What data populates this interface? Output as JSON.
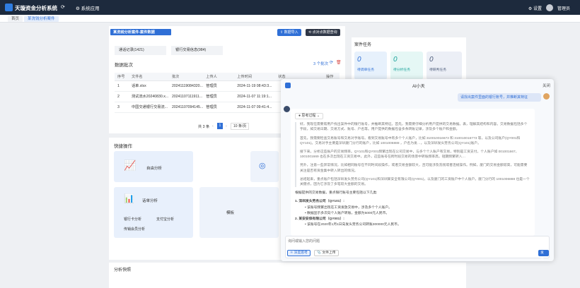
{
  "header": {
    "title": "天璇资金分析系统",
    "sys_app": "系统应用",
    "settings": "设置",
    "user": "管理员"
  },
  "tabs": [
    {
      "label": "首页"
    },
    {
      "label": "某洗钱分析案件"
    }
  ],
  "case_panel": {
    "title": "某洗钱分析案件-案件数据",
    "import_btn": "数据导入",
    "query_btn": "点对点数据查询",
    "sub_tabs": [
      "通话记录(1421)",
      "银行交易信息(984)"
    ],
    "batch_title": "数据批次",
    "batch_count": "3 个批次",
    "columns": [
      "序号",
      "文件名",
      "批次",
      "上传人",
      "上传时间",
      "状态",
      "操作"
    ],
    "rows": [
      [
        "1",
        "话单.xlsx",
        "20241119084320...",
        "管理员",
        "2024-11-19 08:43:3..."
      ],
      [
        "2",
        "测试流水20240830.x...",
        "20241107111911...",
        "管理员",
        "2024-11-07 11:19:1..."
      ],
      [
        "3",
        "中国交通银行交易流...",
        "20241107094145...",
        "管理员",
        "2024-11-07 09:41:4..."
      ]
    ],
    "pagination": {
      "total": "共 3 条",
      "page": "1",
      "size": "10 条/页"
    }
  },
  "tasks": {
    "title": "案件任务",
    "items": [
      {
        "count": "0",
        "label": "待调单任务"
      },
      {
        "count": "0",
        "label": "待分析任务"
      },
      {
        "count": "0",
        "label": "待研判任务"
      }
    ]
  },
  "quick": {
    "title": "快捷操作",
    "items": [
      "自由分析",
      "话单分析",
      "模板"
    ],
    "subs": [
      "银行卡分析",
      "支付宝分析",
      "传销会员分析"
    ]
  },
  "snapshot": {
    "title": "分析快照"
  },
  "chat": {
    "title": "AI小天",
    "close": "关闭",
    "user_msg": "请找出案件里面的银行账号，并推断其特征",
    "thinking": "思考过程",
    "p1": "好，我现在需要帮用户找出案件中的银行账号，并推断其特征。首先，我需要仔细分析用户提供的交易数据。表，理解其结构和内容。交易数据包括多个字段，如交易日期、交易方式、账号、户名等。用户提供的数据包含多条转账记录，涉及多个账户和金额。",
    "p2": "首先，我需要检查交易账号和交易对手账号。看到交易账号中有多个个人账户，比如 310010016673 和 310010016773 等，以及公司账户(QY001和QY101)。交易对手主要是深圳厦门分行的账户，比如 1001006888 ，户名为发…，以及深圳发头劳务公司(QY101)账户。",
    "p3": "接下来，分析这些账户的交易频率。QY101和QY001频繁出现在公司交易中，与多个个人账户有交易，特别是工资支付。个人账户如 001001667、 1001001669 也在多次出现在工资交易中。此外，这些账号在跨时段交易的场景中转账频率高，短期频繁转入…",
    "p4": "另外，注意一些异常情况，比如相同账号在不同时间段操作，或者交易金额较大，且可能涉及洗钱或者违规操作。例如，厦门的交易金额较高，可能需要关注是否有资金集中转入转出的情况。",
    "p5": "总结起来，重点账户包括深圳发头劳务公司(QY101)和深圳某安全有限公司(QY001)，以及厦门的工资账户中个人账户。厦门分行的 1001006888 也是一个关键点，因为它涉及了多笔较大金额的交易。",
    "summary": "根据提供的交易数据，重点银行账号主要包括以下几类:",
    "item1": "1. 深圳发头劳务公司（QY101）:",
    "item1a": "该账号频繁出现在工资发放交易中，涉及多个个人账户。",
    "item1b": "数据显示多次向个人账户转账，金额为5000元人民币。",
    "item2": "2. 某安安保有限公司（QY001）:",
    "item2a": "该账号在2020年1月1日向发头劳务公司转账300000元人民币。",
    "input_placeholder": "询问或输入您的问题",
    "deep_think": "深度思考",
    "upload": "文件上传",
    "send": "发送"
  }
}
